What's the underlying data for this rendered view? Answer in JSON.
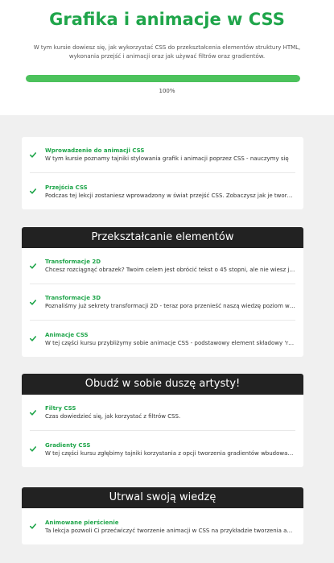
{
  "course": {
    "title": "Grafika i animacje w CSS",
    "description": "W tym kursie dowiesz się, jak wykorzystać CSS do przekształcenia elementów struktury HTML, wykonania przejść i animacji oraz jak używać filtrów oraz gradientów.",
    "progress_value": 100,
    "progress_label": "100%"
  },
  "sections": [
    {
      "title": "",
      "lessons": [
        {
          "title": "Wprowadzenie do animacji CSS",
          "description": "W tym kursie poznamy tajniki stylowania grafik i animacji poprzez CSS - nauczymy się",
          "completed": true
        },
        {
          "title": "Przejścia CSS",
          "description": "Podczas tej lekcji zostaniesz wprowadzony w świat przejść CSS. Zobaczysz jak je tworzyć",
          "completed": true
        }
      ]
    },
    {
      "title": "Przekształcanie elementów",
      "lessons": [
        {
          "title": "Transformacje 2D",
          "description": "Chcesz rozciągnąć obrazek? Twoim celem jest obrócić tekst o 45 stopni, ale nie wiesz jak",
          "completed": true
        },
        {
          "title": "Transformacje 3D",
          "description": "Poznaliśmy już sekrety transformacji 2D - teraz pora przenieść naszą wiedzę poziom wyżej",
          "completed": true
        },
        {
          "title": "Animacje CSS",
          "description": "W tej części kursu przybliżymy sobie animacje CSS - podstawowy element składowy 'rusza",
          "completed": true
        }
      ]
    },
    {
      "title": "Obudź w sobie duszę artysty!",
      "lessons": [
        {
          "title": "Filtry CSS",
          "description": "Czas dowiedzieć się, jak korzystać z filtrów CSS.",
          "completed": true
        },
        {
          "title": "Gradienty CSS",
          "description": "W tej części kursu zgłębimy tajniki korzystania z opcji tworzenia gradientów wbudowanych",
          "completed": true
        }
      ]
    },
    {
      "title": "Utrwal swoją wiedzę",
      "lessons": [
        {
          "title": "Animowane pierścienie",
          "description": "Ta lekcja pozwoli Ci przećwiczyć tworzenie animacji w CSS na przykładzie tworzenia animowanych",
          "completed": true
        }
      ]
    }
  ],
  "colors": {
    "accent": "#1fa54a",
    "progress_fill": "#4cc25c",
    "section_header": "#222222",
    "background": "#f0f0f0"
  },
  "icons": {
    "lesson_status": "check-icon"
  }
}
